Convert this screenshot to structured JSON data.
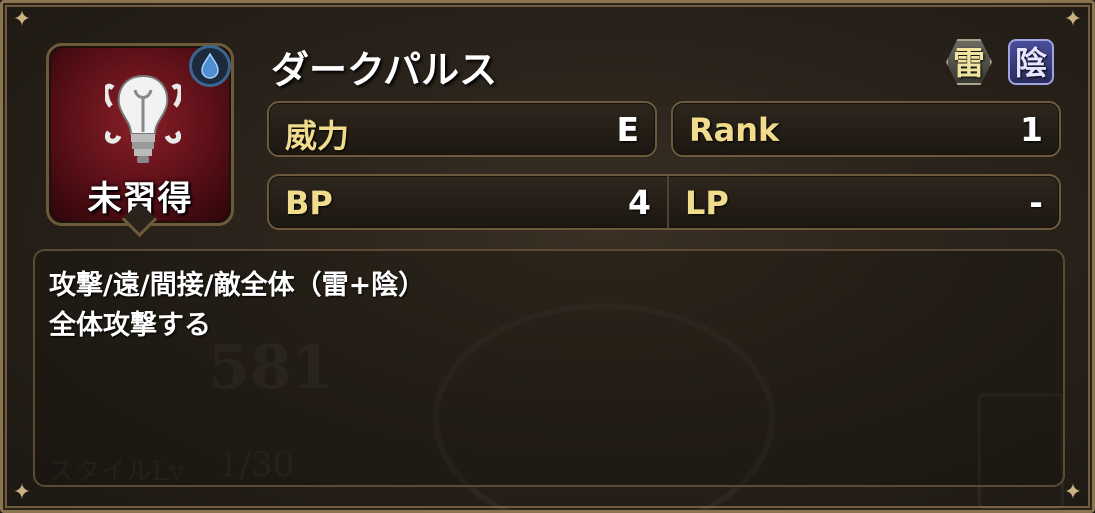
{
  "skill": {
    "name": "ダークパルス",
    "status_label": "未習得",
    "elements": [
      {
        "name": "thunder-element-icon",
        "label": "雷"
      },
      {
        "name": "yin-element-icon",
        "label": "陰"
      }
    ]
  },
  "stats": {
    "power": {
      "label": "威力",
      "value": "E"
    },
    "rank": {
      "label": "Rank",
      "value": "1"
    },
    "bp": {
      "label": "BP",
      "value": "4"
    },
    "lp": {
      "label": "LP",
      "value": "-"
    }
  },
  "description": {
    "line1": "攻撃/遠/間接/敵全体（雷+陰）",
    "line2": "全体攻撃する"
  },
  "background": {
    "number": "581",
    "style_level_label": "スタイルLv",
    "style_level_value": "1/30"
  },
  "icons": {
    "skill_icon": "lightbulb-icon",
    "badge": "water-drop-icon"
  },
  "colors": {
    "label_gold": "#f0dc8c",
    "frame_bronze": "#8a7550",
    "icon_red": "#8a1f28"
  }
}
